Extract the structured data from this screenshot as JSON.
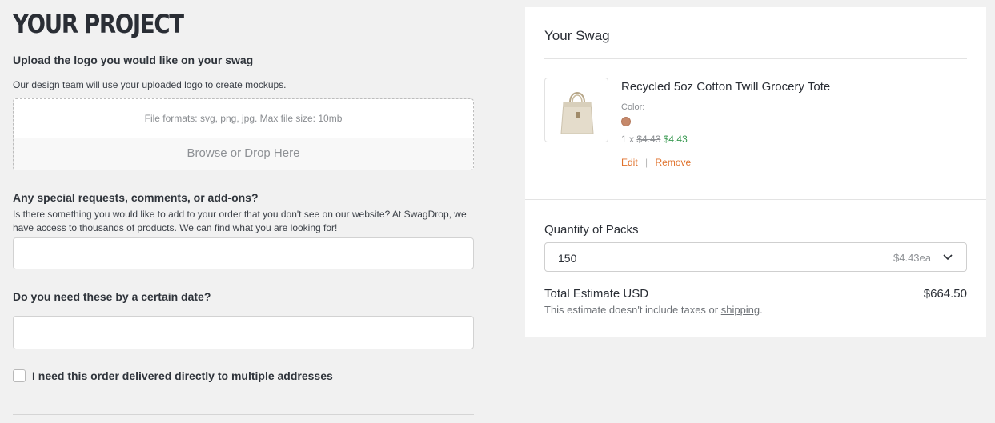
{
  "project": {
    "title": "YOUR PROJECT",
    "upload": {
      "heading": "Upload the logo you would like on your swag",
      "description": "Our design team will use your uploaded logo to create mockups.",
      "formats": "File formats: svg, png, jpg. Max file size: 10mb",
      "browse": "Browse or Drop Here"
    },
    "requests": {
      "heading": "Any special requests, comments, or add-ons?",
      "description_line1": "Is there something you would like to add to your order that you don't see on our website? At SwagDrop, we",
      "description_line2": "have access to thousands of products. We can find what you are looking for!",
      "value": ""
    },
    "date": {
      "heading": "Do you need these by a certain date?",
      "value": ""
    },
    "multi_address": {
      "label": "I need this order delivered directly to multiple addresses",
      "checked": false
    }
  },
  "swag": {
    "title": "Your Swag",
    "item": {
      "name": "Recycled 5oz Cotton Twill Grocery Tote",
      "color_label": "Color:",
      "color": "#c6896b",
      "qty_prefix": "1 x",
      "old_price": "$4.43",
      "new_price": "$4.43",
      "edit": "Edit",
      "separator": "|",
      "remove": "Remove",
      "image_icon": "tote-bag-icon"
    },
    "quantity": {
      "label": "Quantity of Packs",
      "value": "150",
      "unit_price": "$4.43ea"
    },
    "total": {
      "label": "Total Estimate USD",
      "value": "$664.50",
      "note_prefix": "This estimate doesn't include taxes or",
      "note_link": "shipping",
      "note_suffix": "."
    }
  }
}
